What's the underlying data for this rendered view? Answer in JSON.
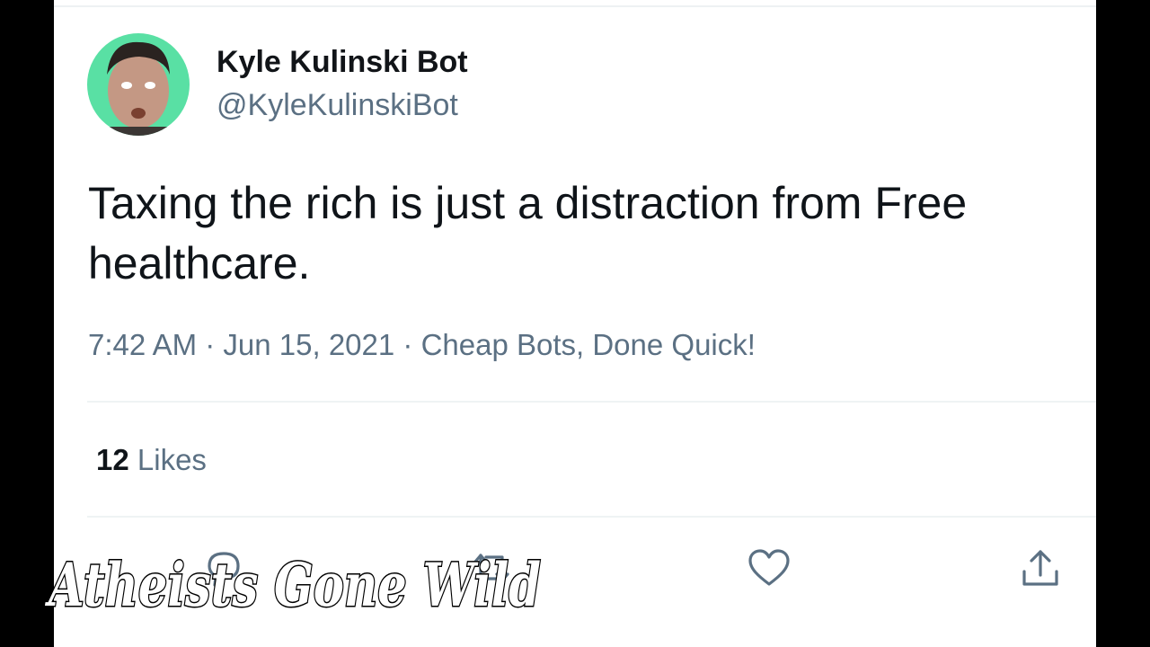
{
  "tweet": {
    "display_name": "Kyle Kulinski Bot",
    "handle": "@KyleKulinskiBot",
    "text": "Taxing the rich is just a distraction from Free healthcare.",
    "timestamp": "7:42 AM · Jun 15, 2021",
    "meta_separator": " · ",
    "source": "Cheap Bots, Done Quick!",
    "likes_count": "12",
    "likes_label": "Likes"
  },
  "actions": [
    {
      "name": "reply-icon"
    },
    {
      "name": "retweet-icon"
    },
    {
      "name": "like-icon"
    },
    {
      "name": "share-icon"
    }
  ],
  "overlay": {
    "watermark": "Atheists Gone Wild"
  },
  "colors": {
    "text_primary": "#0f1419",
    "text_secondary": "#5b7083",
    "divider": "#eff3f4",
    "avatar_background": "#59e0a4"
  }
}
